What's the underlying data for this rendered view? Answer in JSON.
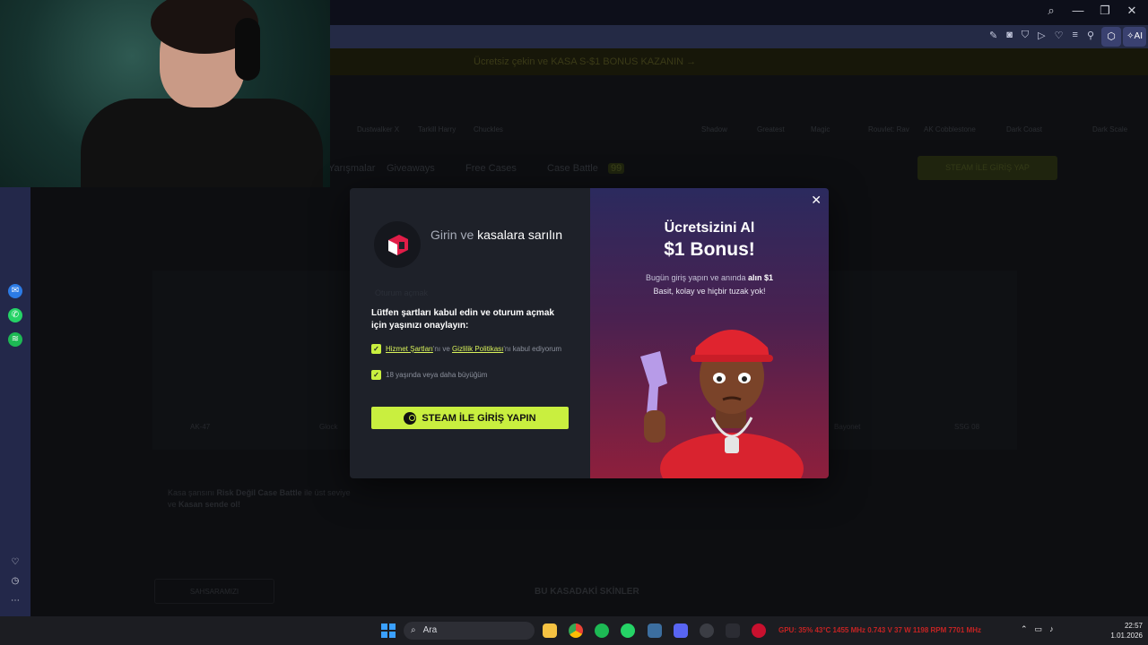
{
  "browser": {
    "toolbar_icons": [
      "edit-icon",
      "camera-icon",
      "shield-icon",
      "play-icon",
      "heart-icon",
      "menu-icon",
      "profile-icon"
    ],
    "ai_label": "AI",
    "controls": {
      "search": "⌕",
      "minimize": "—",
      "restore": "❐",
      "close": "✕"
    }
  },
  "site": {
    "promo": "Ücretsiz çekin ve KASA S-$1 BONUS KAZANIN →",
    "ticker_items": [
      "Dustwalker X",
      "Tarkill Harry",
      "Chuckles",
      "Shadow",
      "Greatest",
      "Magic",
      "Rouvlet: Rav",
      "AK Cobblestone",
      "Dark Coast",
      "Dark Scale"
    ],
    "nav_links": [
      "Yarışmalar",
      "Giveaways",
      "Free Cases",
      "Case Battle"
    ],
    "nav_badge": "99",
    "login_button": "STEAM İLE GİRİŞ YAP",
    "item_captions": [
      "AK-47",
      "Glock",
      "Bayonet",
      "SSG 08"
    ],
    "info_text_1": "Kasa şansını",
    "info_text_bold": "Risk Değil Case Battle",
    "info_text_2": "ile üst seviye",
    "info_text_3": "ve",
    "info_text_4": "Kasan sende ol!",
    "dim_button": "SAHSARAMIZI",
    "section_heading": "BU KASADAKİ SKİNLER"
  },
  "modal": {
    "title_muted": "Girin ve",
    "title_bold": "kasalara sarılın",
    "ghost_text": "Oturum açmak",
    "terms_heading": "Lütfen şartları kabul edin ve oturum açmak için yaşınızı onaylayın:",
    "check1_link1": "Hizmet Şartları",
    "check1_mid": "'nı ve",
    "check1_link2": "Gizlilik Politikası",
    "check1_end": "'nı kabul ediyorum",
    "check2": "18 yaşında veya daha büyüğüm",
    "steam_button": "STEAM İLE GİRİŞ YAPIN",
    "close": "✕",
    "promo_title": "Ücretsizini Al",
    "promo_amount": "$1 Bonus!",
    "promo_line1_a": "Bugün giriş yapın ve anında",
    "promo_line1_b": "alın $1",
    "promo_line2": "Basit, kolay ve hiçbir tuzak yok!"
  },
  "taskbar": {
    "search_placeholder": "Ara",
    "stats": "GPU: 35% 43°C 1455 MHz 0.743 V 37 W 1198 RPM 7701 MHz",
    "time": "22:57",
    "date": "1.01.2026"
  },
  "colors": {
    "accent": "#c9ef3f",
    "modal_bg": "#1e2129",
    "promo_gradient_top": "#2b2a5e",
    "promo_gradient_bottom": "#8e1f3c"
  }
}
